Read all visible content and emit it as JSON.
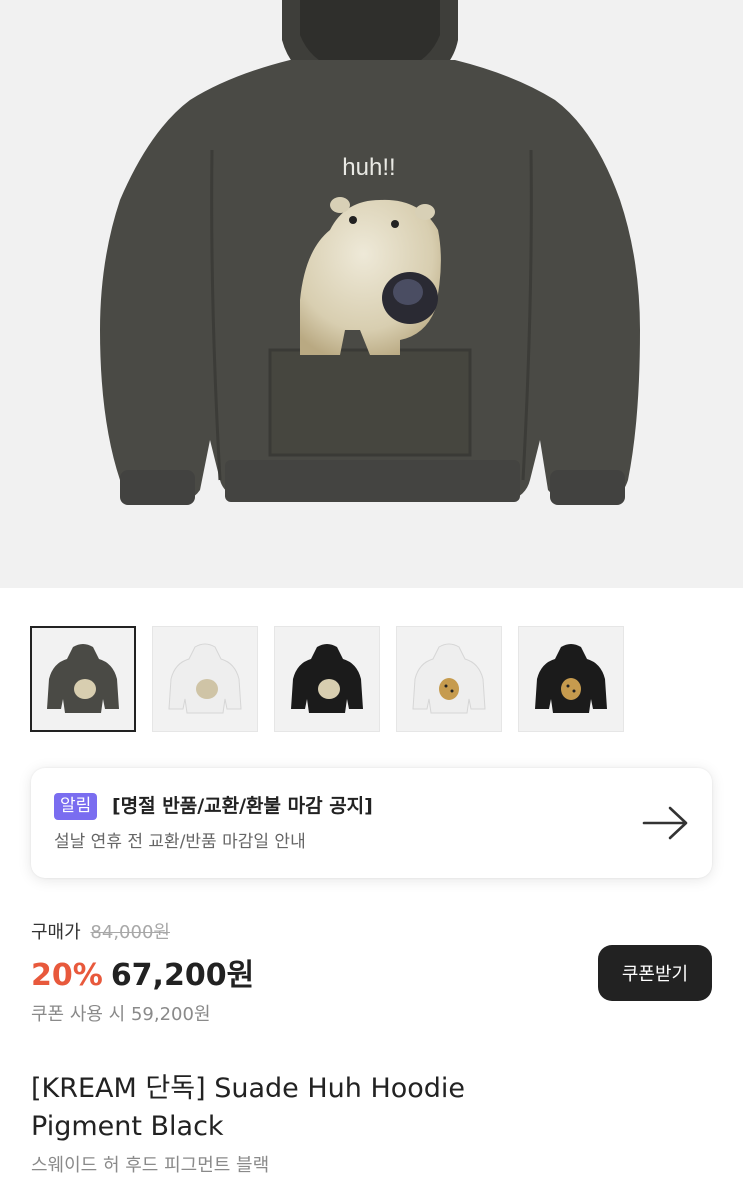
{
  "hero": {
    "print_text": "huh!!",
    "hoodie_color": "#4a4a45",
    "background_color": "#f1f1f1"
  },
  "thumbnails": [
    {
      "colorway": "Pigment Black",
      "hoodie_color": "#4a4a45",
      "graphic": "polar-bear",
      "selected": true
    },
    {
      "colorway": "White",
      "hoodie_color": "#eeeeee",
      "graphic": "polar-bear",
      "selected": false
    },
    {
      "colorway": "Black",
      "hoodie_color": "#1b1b1b",
      "graphic": "polar-bear",
      "selected": false
    },
    {
      "colorway": "White",
      "hoodie_color": "#eeeeee",
      "graphic": "cheetah",
      "selected": false
    },
    {
      "colorway": "Black",
      "hoodie_color": "#1b1b1b",
      "graphic": "cheetah",
      "selected": false
    }
  ],
  "notice": {
    "badge": "알림",
    "title": "[명절 반품/교환/환불 마감 공지]",
    "subtitle": "설날 연휴 전 교환/반품 마감일 안내",
    "icon": "arrow-right-icon"
  },
  "price": {
    "label": "구매가",
    "original": "84,000원",
    "discount": "20%",
    "current": "67,200원",
    "coupon_price": "쿠폰 사용 시 59,200원",
    "accent_color": "#e8593c"
  },
  "coupon_button": {
    "label": "쿠폰받기"
  },
  "product": {
    "title_line1": "[KREAM 단독] Suade Huh Hoodie",
    "title_line2": "Pigment Black",
    "subtitle": "스웨이드 허 후드 피그먼트 블랙"
  }
}
